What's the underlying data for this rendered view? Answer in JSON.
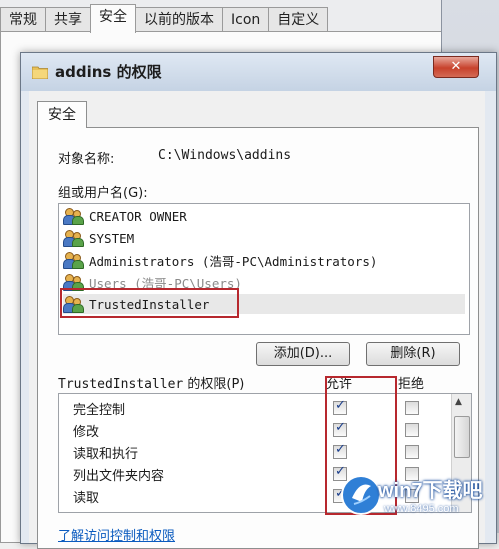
{
  "background_dialog": {
    "tabs": [
      {
        "label": "常规",
        "active": false
      },
      {
        "label": "共享",
        "active": false
      },
      {
        "label": "安全",
        "active": true
      },
      {
        "label": "以前的版本",
        "active": false
      },
      {
        "label": "Icon",
        "active": false
      },
      {
        "label": "自定义",
        "active": false
      }
    ]
  },
  "dialog": {
    "title": "addins 的权限",
    "close_label": "✕",
    "tab_label": "安全",
    "object_name_label": "对象名称:",
    "object_name_value": "C:\\Windows\\addins",
    "group_label": "组或用户名(G):",
    "users": [
      {
        "name": "CREATOR OWNER"
      },
      {
        "name": "SYSTEM"
      },
      {
        "name": "Administrators (浩哥-PC\\Administrators)"
      },
      {
        "name": "Users (浩哥-PC\\Users)"
      },
      {
        "name": "TrustedInstaller",
        "selected": true
      }
    ],
    "add_button": "添加(D)...",
    "remove_button": "删除(R)",
    "perm_label_user": "TrustedInstaller",
    "perm_label_suffix": " 的权限(P)",
    "allow_header": "允许",
    "deny_header": "拒绝",
    "permissions": [
      {
        "name": "完全控制",
        "allow": true,
        "deny": false
      },
      {
        "name": "修改",
        "allow": true,
        "deny": false
      },
      {
        "name": "读取和执行",
        "allow": true,
        "deny": false
      },
      {
        "name": "列出文件夹内容",
        "allow": true,
        "deny": false
      },
      {
        "name": "读取",
        "allow": true,
        "deny": false
      }
    ],
    "bottom_link": "了解访问控制和权限"
  },
  "watermark": {
    "title": "win7下载吧",
    "url": "www.8495.com"
  },
  "colors": {
    "highlight_border": "#b7282e",
    "close_button": "#c7422c",
    "link": "#0b5bbf"
  }
}
